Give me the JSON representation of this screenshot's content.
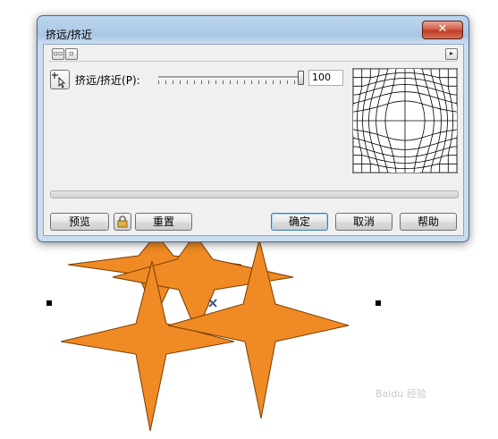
{
  "dialog": {
    "title": "挤远/挤近",
    "close_label": "✕",
    "slider_label": "挤远/挤近(P):",
    "slider_value": "100",
    "slider_fraction": 1.0
  },
  "buttons": {
    "preview": "预览",
    "reset": "重置",
    "ok": "确定",
    "cancel": "取消",
    "help": "帮助"
  },
  "colors": {
    "star_fill": "#f08a24",
    "star_stroke": "#7a3c00",
    "close_red": "#c23a22",
    "handle": "#000000"
  },
  "icons": [
    "pick-tool-icon",
    "lock-icon",
    "center-marker-icon",
    "selection-handle-icon",
    "expand-arrow-icon",
    "two-pane-icon",
    "one-pane-icon"
  ],
  "watermark": "Baidu 经验"
}
